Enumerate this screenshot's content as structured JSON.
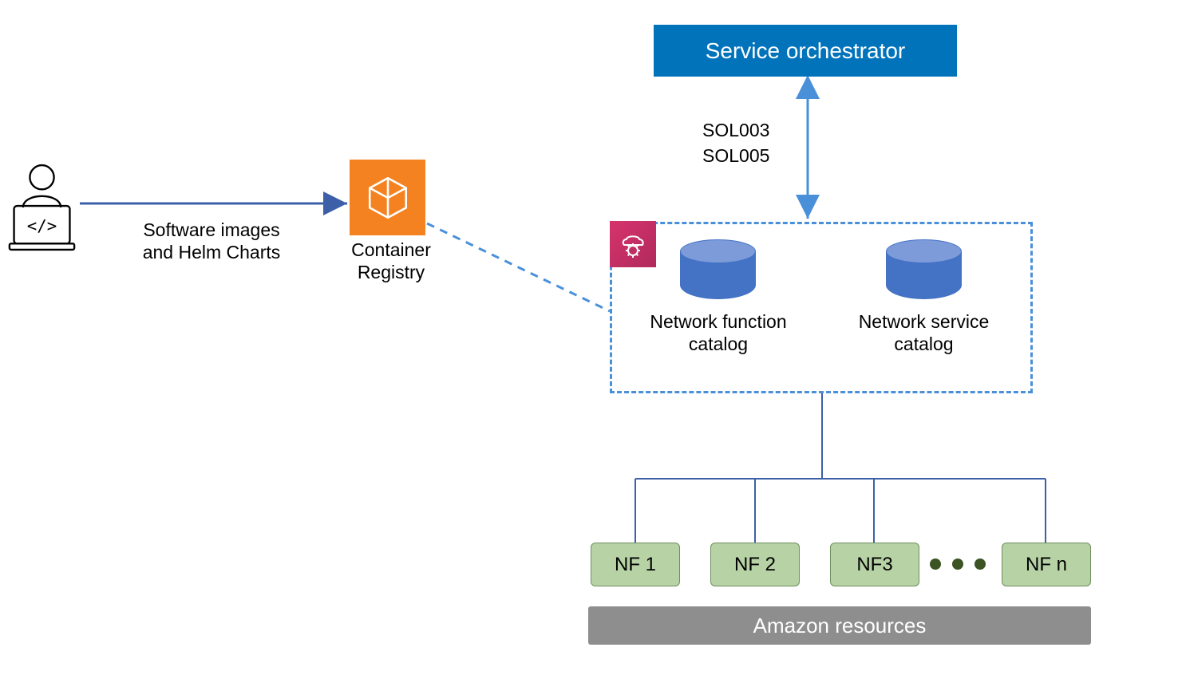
{
  "orchestrator": {
    "title": "Service orchestrator"
  },
  "protocols": {
    "line1": "SOL003",
    "line2": "SOL005"
  },
  "user_caption": "Software images and Helm Charts",
  "registry_caption": "Container Registry",
  "catalogs": {
    "nf": "Network function catalog",
    "ns": "Network service catalog"
  },
  "nfs": {
    "1": "NF 1",
    "2": "NF 2",
    "3": "NF3",
    "n": "NF n"
  },
  "amazon": "Amazon resources"
}
